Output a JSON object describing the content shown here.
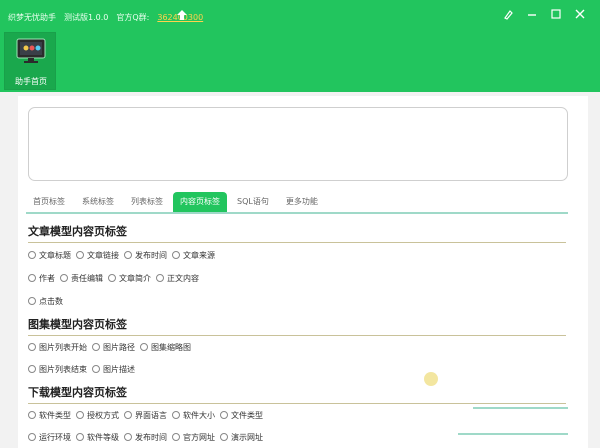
{
  "titlebar": {
    "app_name": "织梦无忧助手",
    "version": "测试版1.0.0",
    "qq_label": "官方Q群:",
    "qq_number": "362400300",
    "upload_icon": "upload-arrow-icon",
    "controls": [
      "skin-icon",
      "minimize-icon",
      "maximize-icon",
      "close-icon"
    ]
  },
  "home_tile": {
    "label": "助手首页",
    "icon": "monitor-icon"
  },
  "colors": {
    "accent": "#22c55e",
    "tab_line": "#9fd9c8"
  },
  "tabs": [
    "首页标签",
    "系统标签",
    "列表标签",
    "内容页标签",
    "SQL语句",
    "更多功能"
  ],
  "active_tab": "内容页标签",
  "sections": [
    {
      "title": "文章模型内容页标签",
      "rows": [
        [
          "文章标题",
          "文章链接",
          "发布时间",
          "文章来源"
        ],
        [
          "作者",
          "责任编辑",
          "文章简介",
          "正文内容"
        ],
        [
          "点击数"
        ]
      ]
    },
    {
      "title": "图集模型内容页标签",
      "rows": [
        [
          "图片列表开始",
          "图片路径",
          "图集缩略图"
        ],
        [
          "图片列表结束",
          "图片描述"
        ]
      ]
    },
    {
      "title": "下载模型内容页标签",
      "rows": [
        [
          "软件类型",
          "授权方式",
          "界面语言",
          "软件大小",
          "文件类型"
        ],
        [
          "运行环境",
          "软件等级",
          "发布时间",
          "官方网址",
          "演示网址"
        ]
      ]
    }
  ]
}
